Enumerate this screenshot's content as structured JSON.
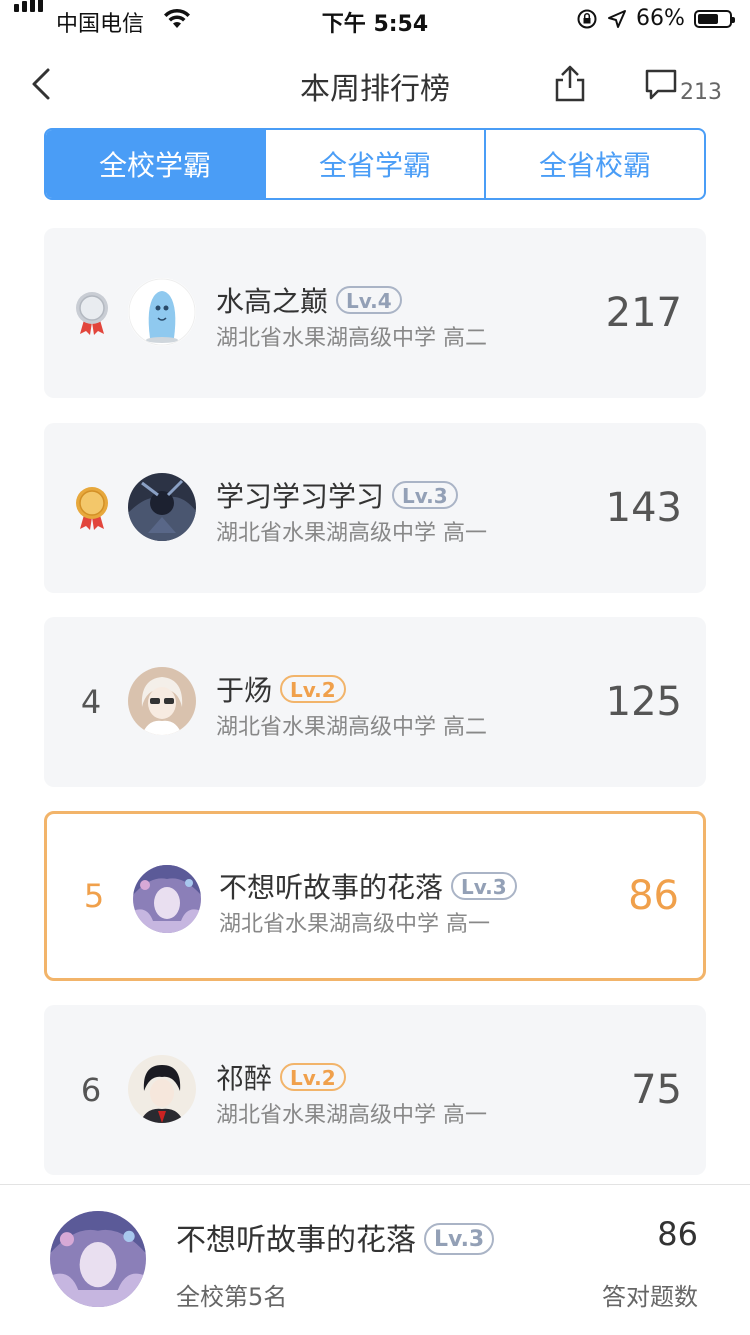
{
  "status_bar": {
    "carrier": "中国电信",
    "time": "下午 5:54",
    "battery_pct": "66%",
    "battery_level": 0.66
  },
  "nav": {
    "title": "本周排行榜",
    "comment_count": "213",
    "back_icon": "chevron-left-icon",
    "share_icon": "share-icon",
    "comment_icon": "comment-icon"
  },
  "tabs": [
    {
      "label": "全校学霸",
      "active": true
    },
    {
      "label": "全省学霸",
      "active": false
    },
    {
      "label": "全省校霸",
      "active": false
    }
  ],
  "ranking": [
    {
      "rank": "",
      "medal": "silver",
      "name": "水高之巅",
      "level": "Lv.4",
      "level_color": "gray",
      "school": "湖北省水果湖高级中学 高二",
      "score": "217"
    },
    {
      "rank": "",
      "medal": "bronze",
      "name": "学习学习学习",
      "level": "Lv.3",
      "level_color": "gray",
      "school": "湖北省水果湖高级中学 高一",
      "score": "143"
    },
    {
      "rank": "4",
      "name": "于炀",
      "level": "Lv.2",
      "level_color": "orange",
      "school": "湖北省水果湖高级中学 高二",
      "score": "125"
    },
    {
      "rank": "5",
      "name": "不想听故事的花落",
      "level": "Lv.3",
      "level_color": "gray",
      "school": "湖北省水果湖高级中学 高一",
      "score": "86",
      "highlight": true
    },
    {
      "rank": "6",
      "name": "祁醉",
      "level": "Lv.2",
      "level_color": "orange",
      "school": "湖北省水果湖高级中学 高一",
      "score": "75"
    }
  ],
  "me": {
    "name": "不想听故事的花落",
    "level": "Lv.3",
    "rank_text": "全校第5名",
    "score": "86",
    "score_label": "答对题数"
  },
  "colors": {
    "accent": "#4a9df6",
    "highlight": "#f0a04b",
    "card_bg": "#f5f6f8"
  }
}
